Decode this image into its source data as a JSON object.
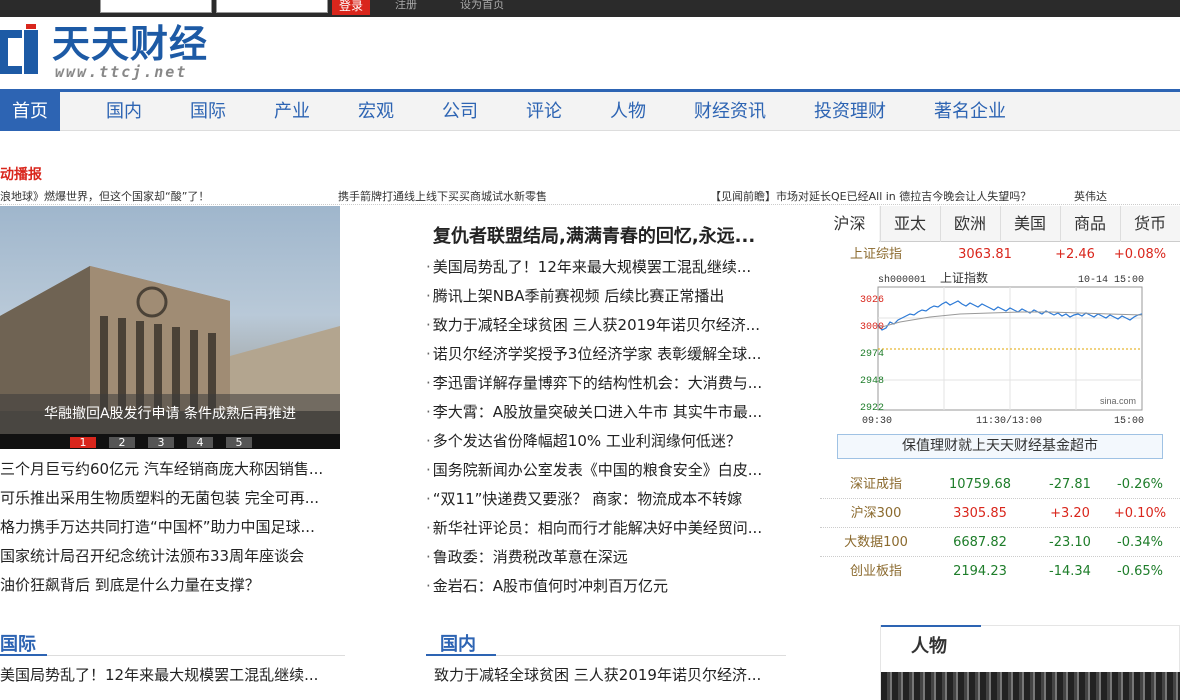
{
  "topbar": {
    "login_label": "登录",
    "register_label": "注册",
    "homepage_label": "设为首页"
  },
  "logo": {
    "cn": "天天财经",
    "en": "www.ttcj.net"
  },
  "nav": {
    "items": [
      "首页",
      "国内",
      "国际",
      "产业",
      "宏观",
      "公司",
      "评论",
      "人物",
      "财经资讯",
      "投资理财",
      "著名企业"
    ]
  },
  "ticker": {
    "title": "动播报",
    "items": [
      "浪地球》燃爆世界，但这个国家却“酸”了！",
      "携手箭牌打通线上线下买买商城试水新零售",
      "【见闻前瞻】市场对延长QE已经All in 德拉吉今晚会让人失望吗？",
      "英伟达"
    ]
  },
  "slideshow": {
    "caption": "华融撤回A股发行申请 条件成熟后再推进",
    "dots": [
      "1",
      "2",
      "3",
      "4",
      "5"
    ]
  },
  "left_list": [
    "三个月巨亏约60亿元 汽车经销商庞大称因销售...",
    "可乐推出采用生物质塑料的无菌包装 完全可再...",
    "格力携手万达共同打造“中国杯”助力中国足球...",
    "国家统计局召开纪念统计法颁布33周年座谈会",
    "油价狂飙背后 到底是什么力量在支撑？"
  ],
  "headline": "复仇者联盟结局,满满青春的回忆,永远...",
  "center_list": [
    "美国局势乱了！12年来最大规模罢工混乱继续...",
    "腾讯上架NBA季前赛视频 后续比赛正常播出",
    "致力于减轻全球贫困 三人获2019年诺贝尔经济...",
    "诺贝尔经济学奖授予3位经济学家 表彰缓解全球...",
    "李迅雷详解存量博弈下的结构性机会：大消费与...",
    "李大霄：A股放量突破关口进入牛市 其实牛市最...",
    "多个发达省份降幅超10% 工业利润缘何低迷？",
    "国务院新闻办公室发表《中国的粮食安全》白皮...",
    "“双11”快递费又要涨？ 商家：物流成本不转嫁",
    "新华社评论员：相向而行才能解决好中美经贸问...",
    "鲁政委：消费税改革意在深远",
    "金岩石：A股市值何时冲刺百万亿元"
  ],
  "market": {
    "tabs": [
      "沪深",
      "亚太",
      "欧洲",
      "美国",
      "商品",
      "货币"
    ],
    "top_quote": {
      "name": "上证综指",
      "value": "3063.81",
      "change": "+2.46",
      "pct": "+0.08%"
    },
    "chart": {
      "code": "sh000001",
      "title": "上证指数",
      "time": "10-14 15:00",
      "source": "sina.com",
      "y_ticks": [
        "3026",
        "3000",
        "2974",
        "2948",
        "2922"
      ],
      "x_ticks": [
        "09:30",
        "11:30/13:00",
        "15:00"
      ]
    },
    "promo": "保值理财就上天天财经基金超市",
    "quotes": [
      {
        "name": "深证成指",
        "value": "10759.68",
        "change": "-27.81",
        "pct": "-0.26%",
        "dir": "dn"
      },
      {
        "name": "沪深300",
        "value": "3305.85",
        "change": "+3.20",
        "pct": "+0.10%",
        "dir": "up"
      },
      {
        "name": "大数据100",
        "value": "6687.82",
        "change": "-23.10",
        "pct": "-0.34%",
        "dir": "dn"
      },
      {
        "name": "创业板指",
        "value": "2194.23",
        "change": "-14.34",
        "pct": "-0.65%",
        "dir": "dn"
      }
    ]
  },
  "sections": {
    "intl": {
      "title": "国际",
      "items": [
        "美国局势乱了！12年来最大规模罢工混乱继续..."
      ]
    },
    "domestic": {
      "title": "国内",
      "items": [
        "致力于减轻全球贫困 三人获2019年诺贝尔经济..."
      ]
    },
    "people": {
      "title": "人物"
    }
  },
  "colors": {
    "accent": "#2d64b3",
    "red": "#d9261c",
    "green": "#1e7d2a"
  }
}
